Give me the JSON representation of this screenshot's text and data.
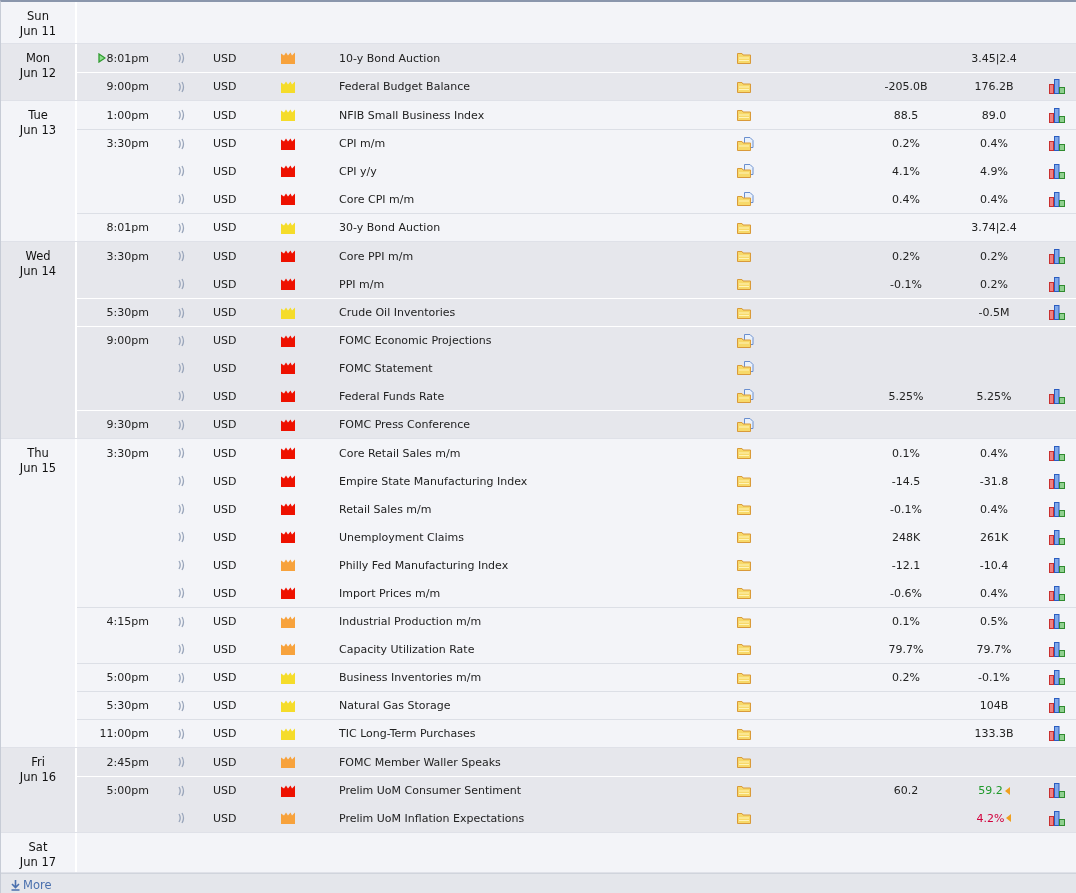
{
  "days": [
    {
      "day": "Sun",
      "date": "Jun 11"
    },
    {
      "day": "Mon",
      "date": "Jun 12",
      "events": [
        {
          "time": "8:01pm",
          "next": true,
          "currency": "USD",
          "color": "#f7a23c",
          "title": "10-y Bond Auction",
          "kind": "folder",
          "value_2": {
            "text": "3.45|2.4",
            "color": "#222222"
          },
          "graph": false
        },
        {
          "time": "9:00pm",
          "next": false,
          "currency": "USD",
          "color": "#f5dc2a",
          "title": "Federal Budget Balance",
          "kind": "folder",
          "value_1": "-205.0B",
          "value_2": {
            "text": "176.2B",
            "color": "#222222"
          },
          "graph": true
        }
      ]
    },
    {
      "day": "Tue",
      "date": "Jun 13",
      "events": [
        {
          "time": "1:00pm",
          "next": false,
          "currency": "USD",
          "color": "#f5dc2a",
          "title": "NFIB Small Business Index",
          "kind": "folder",
          "value_1": "88.5",
          "value_2": {
            "text": "89.0",
            "color": "#222222"
          },
          "graph": true
        },
        {
          "time": "3:30pm",
          "next": false,
          "currency": "USD",
          "color": "#ee1100",
          "title": "CPI m/m",
          "kind": "folder-doc",
          "value_1": "0.2%",
          "value_2": {
            "text": "0.4%",
            "color": "#222222"
          },
          "graph": true
        },
        {
          "next": false,
          "currency": "USD",
          "color": "#ee1100",
          "title": "CPI y/y",
          "kind": "folder-doc",
          "value_1": "4.1%",
          "value_2": {
            "text": "4.9%",
            "color": "#222222"
          },
          "graph": true
        },
        {
          "next": false,
          "currency": "USD",
          "color": "#ee1100",
          "title": "Core CPI m/m",
          "kind": "folder-doc",
          "value_1": "0.4%",
          "value_2": {
            "text": "0.4%",
            "color": "#222222"
          },
          "graph": true
        },
        {
          "time": "8:01pm",
          "next": false,
          "currency": "USD",
          "color": "#f5dc2a",
          "title": "30-y Bond Auction",
          "kind": "folder",
          "value_2": {
            "text": "3.74|2.4",
            "color": "#222222"
          },
          "graph": false
        }
      ]
    },
    {
      "day": "Wed",
      "date": "Jun 14",
      "events": [
        {
          "time": "3:30pm",
          "next": false,
          "currency": "USD",
          "color": "#ee1100",
          "title": "Core PPI m/m",
          "kind": "folder",
          "value_1": "0.2%",
          "value_2": {
            "text": "0.2%",
            "color": "#222222"
          },
          "graph": true
        },
        {
          "next": false,
          "currency": "USD",
          "color": "#ee1100",
          "title": "PPI m/m",
          "kind": "folder",
          "value_1": "-0.1%",
          "value_2": {
            "text": "0.2%",
            "color": "#222222"
          },
          "graph": true
        },
        {
          "time": "5:30pm",
          "next": false,
          "currency": "USD",
          "color": "#f5dc2a",
          "title": "Crude Oil Inventories",
          "kind": "folder",
          "value_2": {
            "text": "-0.5M",
            "color": "#222222"
          },
          "graph": true
        },
        {
          "time": "9:00pm",
          "next": false,
          "currency": "USD",
          "color": "#ee1100",
          "title": "FOMC Economic Projections",
          "kind": "folder-doc",
          "graph": false
        },
        {
          "next": false,
          "currency": "USD",
          "color": "#ee1100",
          "title": "FOMC Statement",
          "kind": "folder-doc",
          "graph": false
        },
        {
          "next": false,
          "currency": "USD",
          "color": "#ee1100",
          "title": "Federal Funds Rate",
          "kind": "folder-doc",
          "value_1": "5.25%",
          "value_2": {
            "text": "5.25%",
            "color": "#222222"
          },
          "graph": true
        },
        {
          "time": "9:30pm",
          "next": false,
          "currency": "USD",
          "color": "#ee1100",
          "title": "FOMC Press Conference",
          "kind": "folder-doc",
          "graph": false
        }
      ]
    },
    {
      "day": "Thu",
      "date": "Jun 15",
      "events": [
        {
          "time": "3:30pm",
          "next": false,
          "currency": "USD",
          "color": "#ee1100",
          "title": "Core Retail Sales m/m",
          "kind": "folder",
          "value_1": "0.1%",
          "value_2": {
            "text": "0.4%",
            "color": "#222222"
          },
          "graph": true
        },
        {
          "next": false,
          "currency": "USD",
          "color": "#ee1100",
          "title": "Empire State Manufacturing Index",
          "kind": "folder",
          "value_1": "-14.5",
          "value_2": {
            "text": "-31.8",
            "color": "#222222"
          },
          "graph": true
        },
        {
          "next": false,
          "currency": "USD",
          "color": "#ee1100",
          "title": "Retail Sales m/m",
          "kind": "folder",
          "value_1": "-0.1%",
          "value_2": {
            "text": "0.4%",
            "color": "#222222"
          },
          "graph": true
        },
        {
          "next": false,
          "currency": "USD",
          "color": "#ee1100",
          "title": "Unemployment Claims",
          "kind": "folder",
          "value_1": "248K",
          "value_2": {
            "text": "261K",
            "color": "#222222"
          },
          "graph": true
        },
        {
          "next": false,
          "currency": "USD",
          "color": "#f7a23c",
          "title": "Philly Fed Manufacturing Index",
          "kind": "folder",
          "value_1": "-12.1",
          "value_2": {
            "text": "-10.4",
            "color": "#222222"
          },
          "graph": true
        },
        {
          "next": false,
          "currency": "USD",
          "color": "#ee1100",
          "title": "Import Prices m/m",
          "kind": "folder",
          "value_1": "-0.6%",
          "value_2": {
            "text": "0.4%",
            "color": "#222222"
          },
          "graph": true
        },
        {
          "time": "4:15pm",
          "next": false,
          "currency": "USD",
          "color": "#f7a23c",
          "title": "Industrial Production m/m",
          "kind": "folder",
          "value_1": "0.1%",
          "value_2": {
            "text": "0.5%",
            "color": "#222222"
          },
          "graph": true
        },
        {
          "next": false,
          "currency": "USD",
          "color": "#f7a23c",
          "title": "Capacity Utilization Rate",
          "kind": "folder",
          "value_1": "79.7%",
          "value_2": {
            "text": "79.7%",
            "color": "#222222"
          },
          "graph": true
        },
        {
          "time": "5:00pm",
          "next": false,
          "currency": "USD",
          "color": "#f5dc2a",
          "title": "Business Inventories m/m",
          "kind": "folder",
          "value_1": "0.2%",
          "value_2": {
            "text": "-0.1%",
            "color": "#222222"
          },
          "graph": true
        },
        {
          "time": "5:30pm",
          "next": false,
          "currency": "USD",
          "color": "#f5dc2a",
          "title": "Natural Gas Storage",
          "kind": "folder",
          "value_2": {
            "text": "104B",
            "color": "#222222"
          },
          "graph": true
        },
        {
          "time": "11:00pm",
          "next": false,
          "currency": "USD",
          "color": "#f5dc2a",
          "title": "TIC Long-Term Purchases",
          "kind": "folder",
          "value_2": {
            "text": "133.3B",
            "color": "#222222"
          },
          "graph": true
        }
      ]
    },
    {
      "day": "Fri",
      "date": "Jun 16",
      "events": [
        {
          "time": "2:45pm",
          "next": false,
          "currency": "USD",
          "color": "#f7a23c",
          "title": "FOMC Member Waller Speaks",
          "kind": "folder",
          "graph": false
        },
        {
          "time": "5:00pm",
          "next": false,
          "currency": "USD",
          "color": "#ee1100",
          "title": "Prelim UoM Consumer Sentiment",
          "kind": "folder",
          "value_1": "60.2",
          "value_2": {
            "text": "59.2",
            "color": "#1f9a2a"
          },
          "revised": true,
          "graph": true
        },
        {
          "next": false,
          "currency": "USD",
          "color": "#f7a23c",
          "title": "Prelim UoM Inflation Expectations",
          "kind": "folder",
          "value_2": {
            "text": "4.2%",
            "color": "#d2003c"
          },
          "revised": true,
          "graph": true
        }
      ]
    },
    {
      "day": "Sat",
      "date": "Jun 17"
    }
  ],
  "more_link": "More"
}
